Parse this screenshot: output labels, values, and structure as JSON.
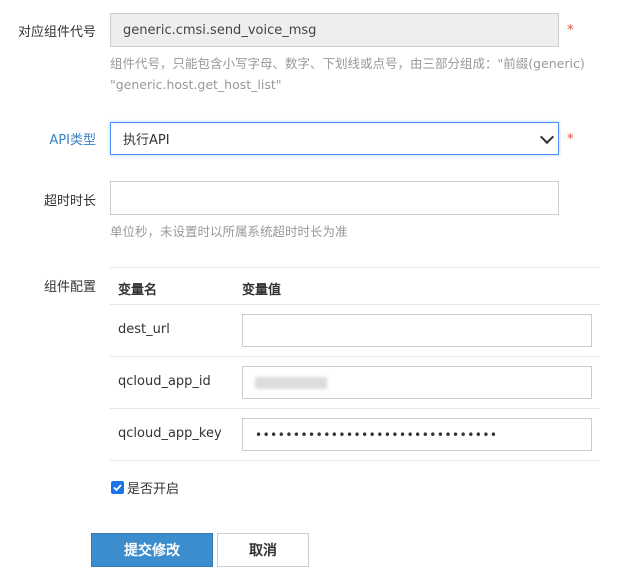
{
  "component_code": {
    "label": "对应组件代号",
    "value": "generic.cmsi.send_voice_msg",
    "required_mark": "*",
    "hint_line1": "组件代号，只能包含小写字母、数字、下划线或点号，由三部分组成：\"前缀(generic)",
    "hint_line2": "\"generic.host.get_host_list\""
  },
  "api_type": {
    "label": "API类型",
    "selected": "执行API",
    "required_mark": "*"
  },
  "timeout": {
    "label": "超时时长",
    "value": "",
    "hint": "单位秒，未设置时以所属系统超时时长为准"
  },
  "config": {
    "label": "组件配置",
    "columns": [
      "变量名",
      "变量值"
    ],
    "rows": [
      {
        "name": "dest_url",
        "value": ""
      },
      {
        "name": "qcloud_app_id",
        "value": ""
      },
      {
        "name": "qcloud_app_key",
        "value": "••••••••••••••••••••••••••••••••"
      }
    ]
  },
  "enabled": {
    "label": "是否开启",
    "checked": true
  },
  "buttons": {
    "submit": "提交修改",
    "cancel": "取消"
  },
  "colors": {
    "primary": "#3c8dcd",
    "label_blue": "#3b82c4",
    "required": "#e2483d",
    "hint": "#999999"
  }
}
